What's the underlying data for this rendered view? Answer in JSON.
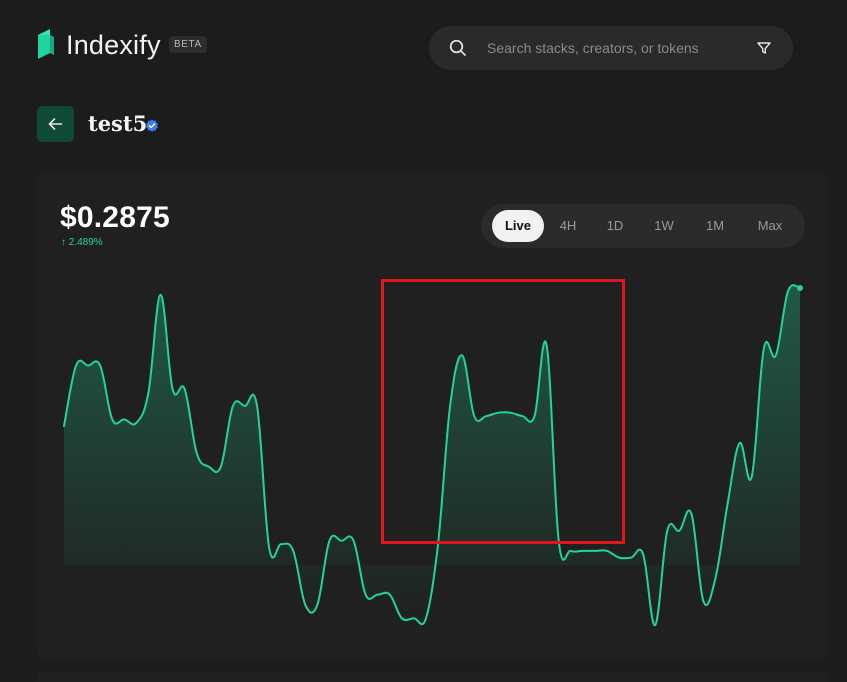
{
  "header": {
    "brand": "Indexify",
    "badge": "BETA",
    "search_placeholder": "Search stacks, creators, or tokens"
  },
  "stack": {
    "title": "test5",
    "verified": true
  },
  "price_card": {
    "price": "$0.2875",
    "change": "↑ 2.489%",
    "ranges": [
      {
        "label": "Live",
        "active": true
      },
      {
        "label": "4H",
        "active": false
      },
      {
        "label": "1D",
        "active": false
      },
      {
        "label": "1W",
        "active": false
      },
      {
        "label": "1M",
        "active": false
      },
      {
        "label": "Max",
        "active": false
      }
    ]
  },
  "chart_data": {
    "type": "area",
    "title": "",
    "xlabel": "",
    "ylabel": "",
    "grid": false,
    "ylim": [
      0,
      100
    ],
    "x": [
      0,
      1,
      2,
      3,
      4,
      5,
      6,
      7,
      8,
      9,
      10,
      11,
      12,
      13,
      14,
      15,
      16,
      17,
      18,
      19,
      20,
      21,
      22,
      23,
      24,
      25,
      26,
      27,
      28,
      29,
      30,
      31,
      32,
      33,
      34,
      35,
      36,
      37,
      38,
      39,
      40,
      41,
      42,
      43,
      44,
      45,
      46,
      47,
      48,
      49,
      50,
      51,
      52,
      53,
      54,
      55,
      56,
      57,
      58,
      59,
      60,
      61,
      62,
      63,
      64,
      65,
      66,
      67,
      68,
      69,
      70,
      71,
      72,
      73,
      74,
      75,
      76,
      77,
      78,
      79,
      80
    ],
    "values": [
      59,
      77,
      77,
      77,
      61,
      61,
      60,
      69,
      98,
      70,
      70,
      51,
      47,
      47,
      65,
      65,
      65,
      23,
      24,
      22,
      6,
      6,
      25,
      25,
      25,
      9,
      9,
      9,
      2,
      2,
      2,
      24,
      65,
      80,
      62,
      62,
      63,
      63,
      62,
      62,
      83,
      25,
      22,
      22,
      22,
      22,
      20,
      20,
      21,
      0,
      28,
      28,
      33,
      7,
      14,
      36,
      54,
      44,
      82,
      80,
      99,
      100
    ],
    "series_color": "#21d49b"
  },
  "colors": {
    "accent": "#21d49b",
    "back_button_bg": "#0f4a35",
    "highlight_box": "#e0161a",
    "background": "#1c1c1c",
    "card": "#202020"
  }
}
